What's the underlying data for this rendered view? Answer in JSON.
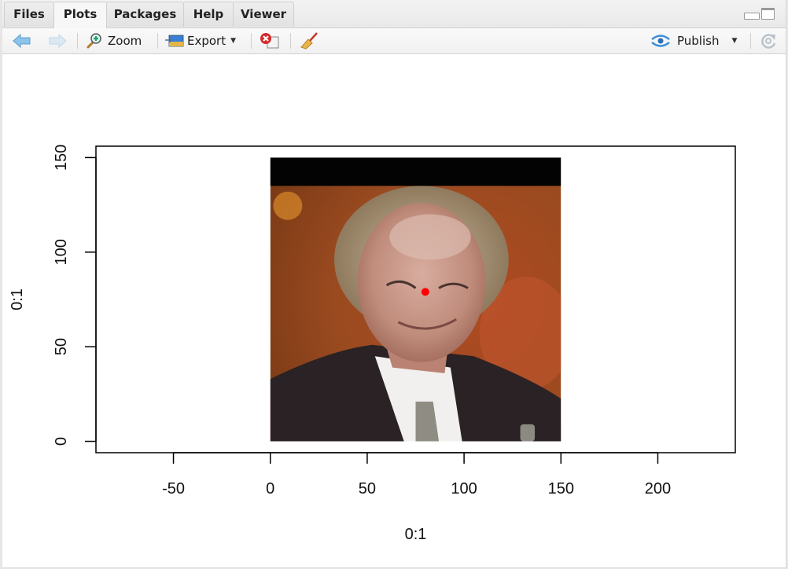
{
  "tabs": [
    {
      "label": "Files",
      "active": false
    },
    {
      "label": "Plots",
      "active": true
    },
    {
      "label": "Packages",
      "active": false
    },
    {
      "label": "Help",
      "active": false
    },
    {
      "label": "Viewer",
      "active": false
    }
  ],
  "toolbar": {
    "back_icon": "arrow-left-icon",
    "forward_icon": "arrow-right-icon",
    "zoom_label": "Zoom",
    "export_label": "Export",
    "remove_plot_icon": "remove-plot-icon",
    "clear_all_icon": "broom-icon",
    "publish_label": "Publish",
    "refresh_icon": "refresh-icon"
  },
  "colors": {
    "point": "#ff0000",
    "axis": "#000000",
    "image_top_band": "#030303"
  },
  "chart_data": {
    "type": "scatter",
    "title": "",
    "xlabel": "0:1",
    "ylabel": "0:1",
    "xlim": [
      -90,
      240
    ],
    "ylim": [
      -6,
      156
    ],
    "x_ticks": [
      -50,
      0,
      50,
      100,
      150,
      200
    ],
    "y_ticks": [
      0,
      50,
      100,
      150
    ],
    "grid": false,
    "background_image": {
      "description": "photo of a smiling man in a dark suit and white shirt, black band along the top",
      "extent_x": [
        0,
        150
      ],
      "extent_y": [
        0,
        150
      ],
      "black_band_y": [
        135,
        150
      ]
    },
    "points": [
      {
        "x": 80,
        "y": 79,
        "color": "#ff0000"
      }
    ]
  }
}
